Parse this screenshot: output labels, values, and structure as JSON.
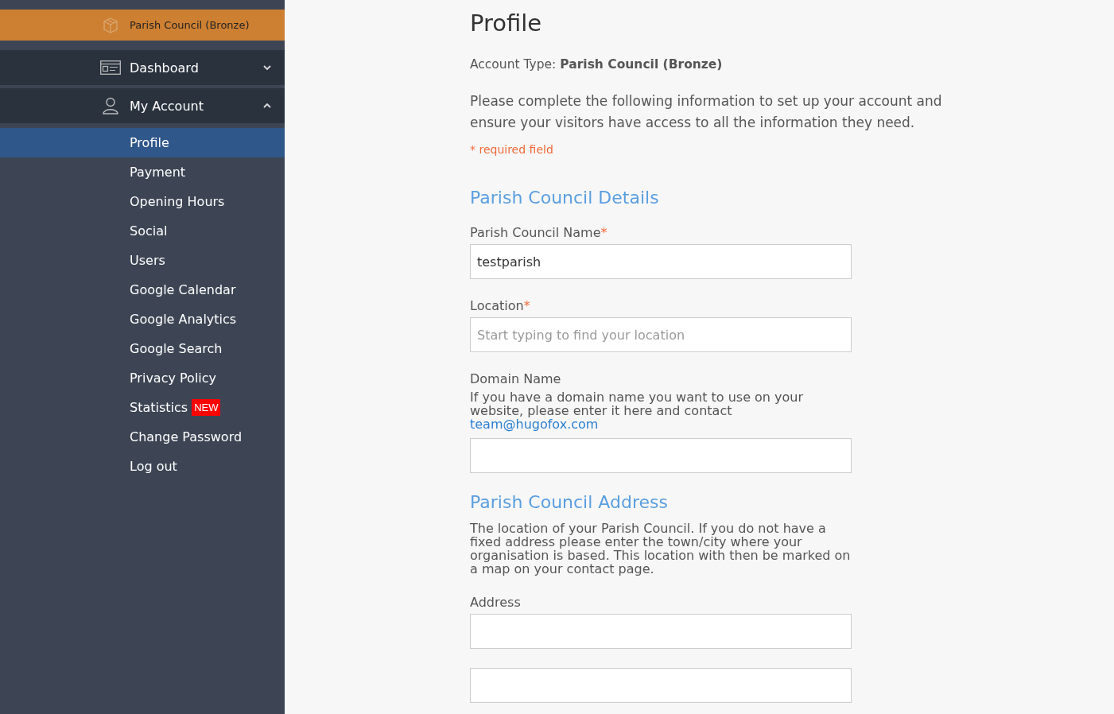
{
  "sidebar": {
    "account": {
      "label": "Parish Council (Bronze)"
    },
    "nav": [
      {
        "label": "Dashboard",
        "expanded": false
      },
      {
        "label": "My Account",
        "expanded": true
      }
    ],
    "subitems": [
      {
        "label": "Profile",
        "selected": true
      },
      {
        "label": "Payment",
        "selected": false
      },
      {
        "label": "Opening Hours",
        "selected": false
      },
      {
        "label": "Social",
        "selected": false
      },
      {
        "label": "Users",
        "selected": false
      },
      {
        "label": "Google Calendar",
        "selected": false
      },
      {
        "label": "Google Analytics",
        "selected": false
      },
      {
        "label": "Google Search",
        "selected": false
      },
      {
        "label": "Privacy Policy",
        "selected": false
      },
      {
        "label": "Statistics",
        "selected": false,
        "badge": "NEW"
      },
      {
        "label": "Change Password",
        "selected": false
      },
      {
        "label": "Log out",
        "selected": false
      }
    ]
  },
  "main": {
    "title": "Profile",
    "account_type": "Account Type: **Parish Council (Bronze)**",
    "intro": "Please complete the following information to set up your account and ensure your visitors have access to all the information they need.",
    "required_note": "* required field",
    "blocks": [
      {
        "kind": "heading",
        "text": "Parish Council Details"
      },
      {
        "kind": "field",
        "label": "Parish Council Name",
        "required_mark": "*",
        "value": "testparish"
      },
      {
        "kind": "field",
        "label": "Location",
        "required_mark": "*",
        "placeholder": "Start typing to find your location"
      },
      {
        "kind": "field",
        "label": "Domain Name",
        "help": "If you have a domain name you want to use on your website, please enter it here and contact",
        "link": "team@hugofox.com"
      },
      {
        "kind": "heading",
        "text": "Parish Council Address"
      },
      {
        "kind": "help",
        "text": "The location of your Parish Council. If you do not have a fixed address please enter the town/city where your organisation is based. This location with then be marked on a map on your contact page."
      },
      {
        "kind": "field",
        "label": "Address"
      },
      {
        "kind": "field"
      }
    ]
  }
}
